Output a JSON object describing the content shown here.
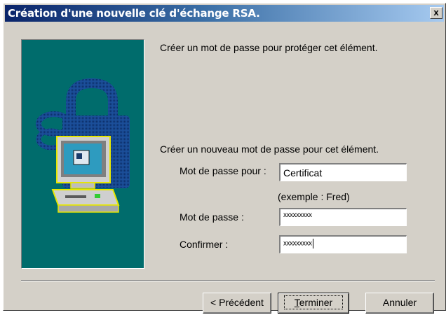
{
  "window": {
    "title": "Création d'une nouvelle clé d'échange RSA.",
    "close_label": "x"
  },
  "content": {
    "intro": "Créer un mot de passe pour protéger cet élément.",
    "subtitle": "Créer un nouveau mot de passe pour cet élément.",
    "password_for_label": "Mot de passe pour :",
    "password_for_value": "Certificat",
    "example_hint": "(exemple : Fred)",
    "password_label": "Mot de passe :",
    "password_value": "xxxxxxxxx",
    "confirm_label": "Confirmer :",
    "confirm_value": "xxxxxxxxx"
  },
  "buttons": {
    "previous": "< Précédent",
    "finish_first": "T",
    "finish_rest": "erminer",
    "cancel": "Annuler"
  },
  "colors": {
    "titlebar_start": "#0a246a",
    "titlebar_end": "#a6caf0",
    "dialog_bg": "#d4d0c8",
    "art_bg": "#006c6c"
  },
  "icons": {
    "art": "computer-with-padlock-illustration"
  }
}
